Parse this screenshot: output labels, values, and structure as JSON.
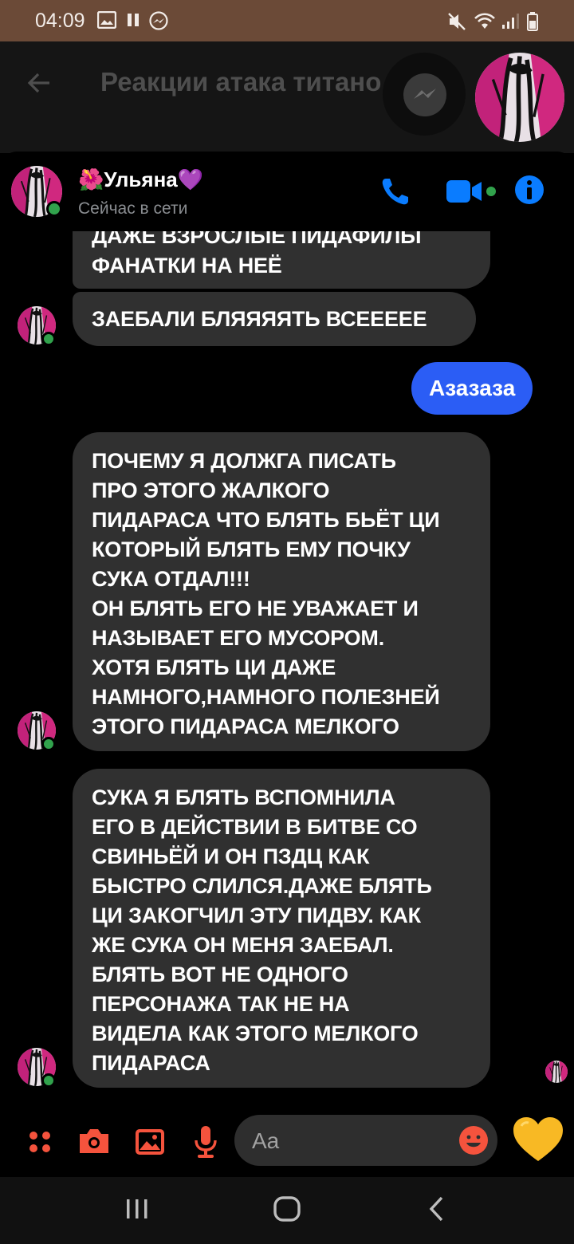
{
  "status_bar": {
    "time": "04:09",
    "left_icons": [
      "gallery-icon",
      "pause-icon",
      "messenger-icon"
    ],
    "right_icons": [
      "mute-icon",
      "wifi-icon",
      "signal-icon",
      "battery-icon"
    ]
  },
  "background_app": {
    "title": "Реакции атака титано"
  },
  "chat_header": {
    "name_emoji": "🌺",
    "name": "Ульяна",
    "name_heart": "💜",
    "status": "Сейчас в сети",
    "icons": [
      "phone-icon",
      "video-icon",
      "info-icon"
    ]
  },
  "messages": [
    {
      "direction": "incoming",
      "lines": [
        "ДАЖЕ ВЗРОСЛЫЕ ПИДАФИЛЫ",
        "ФАНАТКИ НА НЕЁ"
      ]
    },
    {
      "direction": "incoming",
      "lines": [
        "ЗАЕБАЛИ БЛЯЯЯЯТЬ ВСЕЕЕЕЕ"
      ]
    },
    {
      "direction": "outgoing",
      "text": "Азазаза"
    },
    {
      "direction": "incoming",
      "lines": [
        "ПОЧЕМУ Я ДОЛЖГА ПИСАТЬ",
        "ПРО ЭТОГО ЖАЛКОГО",
        "ПИДАРАСА ЧТО БЛЯТЬ БЬЁТ ЦИ",
        "КОТОРЫЙ БЛЯТЬ ЕМУ ПОЧКУ",
        "СУКА ОТДАЛ!!!",
        "ОН БЛЯТЬ ЕГО НЕ УВАЖАЕТ И",
        "НАЗЫВАЕТ ЕГО МУСОРОМ.",
        "ХОТЯ БЛЯТЬ ЦИ ДАЖЕ",
        "НАМНОГО,НАМНОГО ПОЛЕЗНЕЙ",
        "ЭТОГО ПИДАРАСА МЕЛКОГО"
      ]
    },
    {
      "direction": "incoming",
      "lines": [
        "СУКА Я БЛЯТЬ ВСПОМНИЛА",
        "ЕГО В ДЕЙСТВИИ В БИТВЕ СО",
        "СВИНЬЁЙ И ОН ПЗДЦ КАК",
        "БЫСТРО СЛИЛСЯ.ДАЖЕ БЛЯТЬ",
        "ЦИ ЗАКОГЧИЛ ЭТУ ПИДВУ. КАК",
        "ЖЕ СУКА ОН МЕНЯ ЗАЕБАЛ.",
        "БЛЯТЬ ВОТ НЕ ОДНОГО",
        "ПЕРСОНАЖА ТАК НЕ НА",
        "ВИДЕЛА КАК ЭТОГО МЕЛКОГО",
        "ПИДАРАСА"
      ]
    }
  ],
  "composer": {
    "placeholder": "Aa",
    "icons": [
      "apps-icon",
      "camera-icon",
      "gallery-icon",
      "microphone-icon",
      "emoji-icon",
      "yellow-heart-icon"
    ]
  },
  "colors": {
    "accent": "#0a7cff",
    "composer_accent": "#f5533d",
    "outgoing_bubble": "#2b5df5",
    "incoming_bubble": "#303030",
    "online": "#31a24c",
    "status_bar": "#6b4a37"
  },
  "nav_bar": {
    "icons": [
      "recent-apps-icon",
      "home-icon",
      "back-icon"
    ]
  }
}
